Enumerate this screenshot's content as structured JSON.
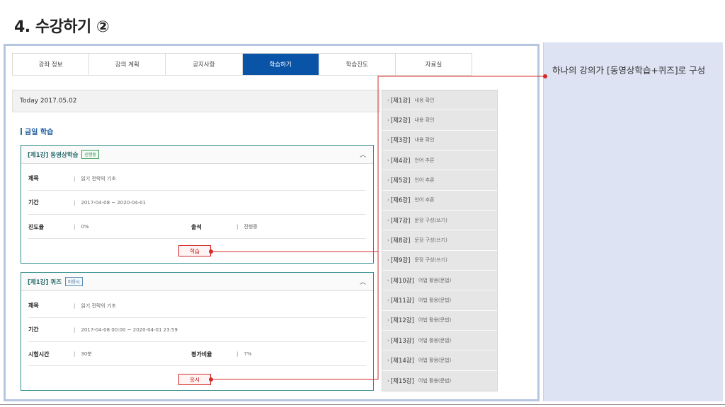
{
  "slide": {
    "title": "4. 수강하기 ②",
    "annotation": "하나의 강의가 [동영상학습+퀴즈]로 구성"
  },
  "tabs": [
    {
      "label": "강좌 정보",
      "active": false
    },
    {
      "label": "강의 계획",
      "active": false
    },
    {
      "label": "공지사항",
      "active": false
    },
    {
      "label": "학습하기",
      "active": true
    },
    {
      "label": "학습진도",
      "active": false
    },
    {
      "label": "자료실",
      "active": false
    }
  ],
  "today_label": "Today 2017.05.02",
  "section_title": "금일 학습",
  "video_card": {
    "title": "[제1강] 동영상학습",
    "badge": "진행중",
    "subject_label": "제목",
    "subject_value": "읽기 전략의 기초",
    "period_label": "기간",
    "period_value": "2017-04-08 ~ 2020-04-01",
    "progress_label": "진도율",
    "progress_value": "0%",
    "attendance_label": "출석",
    "attendance_value": "진행중",
    "button": "학습"
  },
  "quiz_card": {
    "title": "[제1강] 퀴즈",
    "badge": "미응시",
    "subject_label": "제목",
    "subject_value": "읽기 전략의 기초",
    "period_label": "기간",
    "period_value": "2017-04-08 00:00 ~ 2020-04-01 23:59",
    "time_label": "시험시간",
    "time_value": "30분",
    "ratio_label": "평가비율",
    "ratio_value": "7%",
    "button": "응시"
  },
  "lessons": [
    {
      "lesson": "[제1강]",
      "topic": "내용 확인"
    },
    {
      "lesson": "[제2강]",
      "topic": "내용 확인"
    },
    {
      "lesson": "[제3강]",
      "topic": "내용 확인"
    },
    {
      "lesson": "[제4강]",
      "topic": "언어 추론"
    },
    {
      "lesson": "[제5강]",
      "topic": "언어 추론"
    },
    {
      "lesson": "[제6강]",
      "topic": "언어 추론"
    },
    {
      "lesson": "[제7강]",
      "topic": "문장 구성(쓰기)"
    },
    {
      "lesson": "[제8강]",
      "topic": "문장 구성(쓰기)"
    },
    {
      "lesson": "[제9강]",
      "topic": "문장 구성(쓰기)"
    },
    {
      "lesson": "[제10강]",
      "topic": "어법 활용(문법)"
    },
    {
      "lesson": "[제11강]",
      "topic": "어법 활용(문법)"
    },
    {
      "lesson": "[제12강]",
      "topic": "어법 활용(문법)"
    },
    {
      "lesson": "[제13강]",
      "topic": "어법 활용(문법)"
    },
    {
      "lesson": "[제14강]",
      "topic": "어법 활용(문법)"
    },
    {
      "lesson": "[제15강]",
      "topic": "어법 활용(문법)"
    }
  ],
  "colors": {
    "active_tab": "#0a54a8",
    "card_border": "#2e8b8b",
    "connector": "#d42a2a",
    "side_panel": "#dde3f3"
  }
}
